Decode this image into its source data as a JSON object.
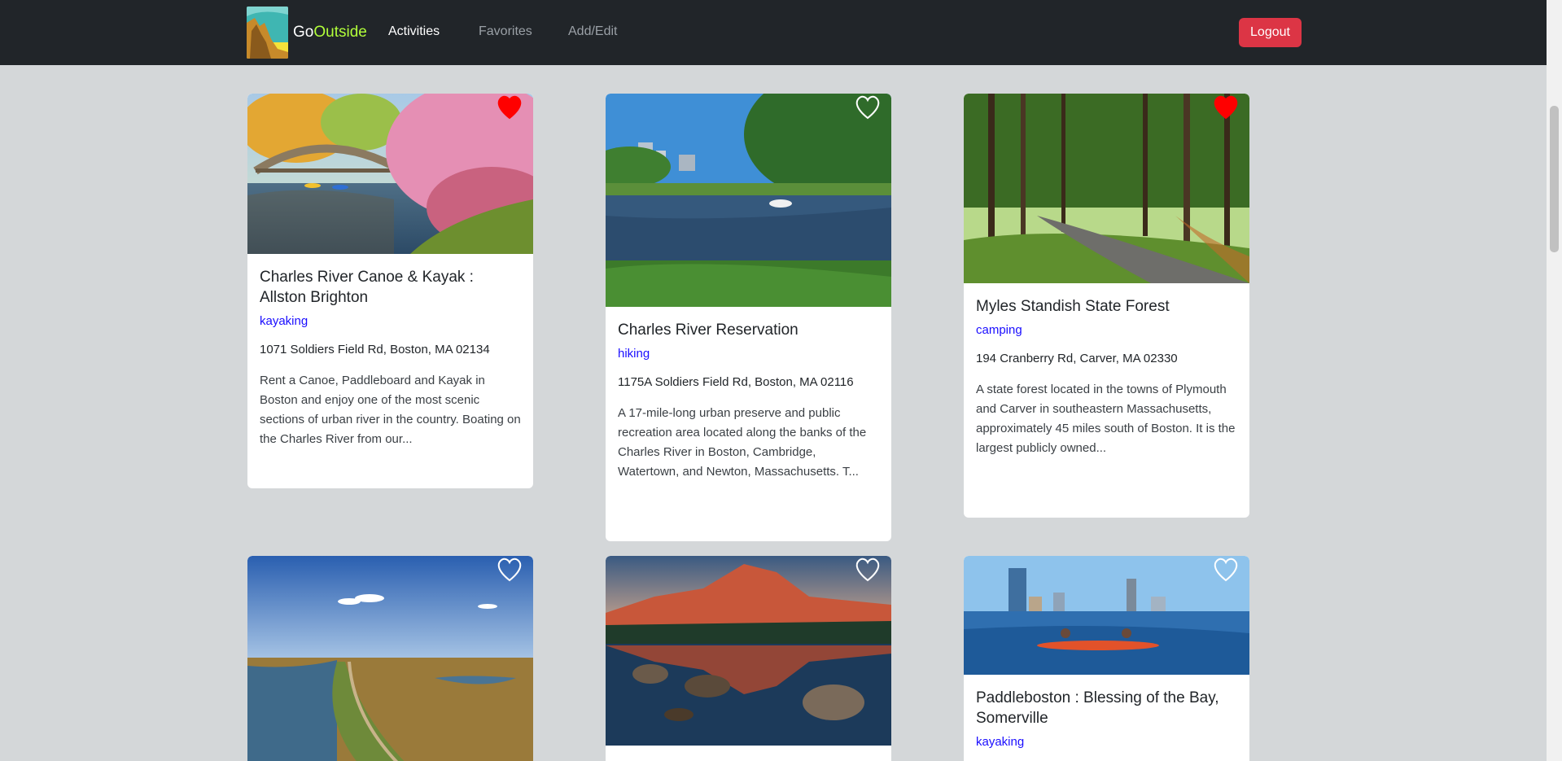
{
  "brand": {
    "go": "Go",
    "outside": "Outside"
  },
  "nav": {
    "activities": "Activities",
    "favorites": "Favorites",
    "add_edit": "Add/Edit"
  },
  "logout": "Logout",
  "cards": [
    {
      "title": "Charles River Canoe & Kayak : Allston Brighton",
      "category": "kayaking",
      "address": "1071 Soldiers Field Rd, Boston, MA 02134",
      "description": "Rent a Canoe, Paddleboard and Kayak in Boston and enjoy one of the most scenic sections of urban river in the country. Boating on the Charles River from our...",
      "favorited": true,
      "image_icon": "bridge-river-kayak-photo"
    },
    {
      "title": "Charles River Reservation",
      "category": "hiking",
      "address": "1175A Soldiers Field Rd, Boston, MA 02116",
      "description": "A 17-mile-long urban preserve and public recreation area located along the banks of the Charles River in Boston, Cambridge, Watertown, and Newton, Massachusetts. T...",
      "favorited": false,
      "image_icon": "river-city-park-photo"
    },
    {
      "title": "Myles Standish State Forest",
      "category": "camping",
      "address": "194 Cranberry Rd, Carver, MA 02330",
      "description": "A state forest located in the towns of Plymouth and Carver in southeastern Massachusetts, approximately 45 miles south of Boston. It is the largest publicly owned...",
      "favorited": true,
      "image_icon": "forest-path-photo"
    },
    {
      "title": "",
      "category": "",
      "address": "",
      "description": "",
      "favorited": false,
      "image_icon": "marsh-trail-photo"
    },
    {
      "title": "",
      "category": "",
      "address": "",
      "description": "",
      "favorited": false,
      "image_icon": "mountain-lake-photo"
    },
    {
      "title": "Paddleboston : Blessing of the Bay, Somerville",
      "category": "kayaking",
      "address": "",
      "description": "",
      "favorited": false,
      "image_icon": "skyline-kayak-photo"
    }
  ],
  "colors": {
    "navbar": "#212529",
    "background": "#d4d7d9",
    "logout": "#dc3545",
    "category_link": "#1a0dff",
    "heart_filled": "#ff0000",
    "brand_accent": "#b2ff3a"
  }
}
